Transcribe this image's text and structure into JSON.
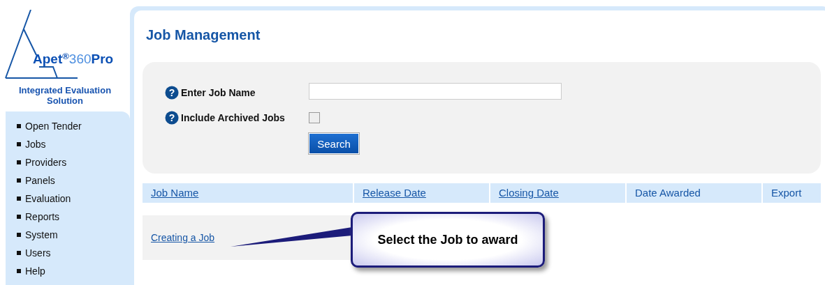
{
  "logo": {
    "wordmark": [
      "Apet",
      "®",
      "360",
      "Pro"
    ],
    "tagline": "Integrated Evaluation Solution"
  },
  "sidebar": {
    "items": [
      "Open Tender",
      "Jobs",
      "Providers",
      "Panels",
      "Evaluation",
      "Reports",
      "System",
      "Users",
      "Help"
    ]
  },
  "page_title": "Job Management",
  "search_form": {
    "job_name": {
      "help_icon": "?",
      "label": "Enter Job Name"
    },
    "archived": {
      "help_icon": "?",
      "label": "Include Archived Jobs",
      "checked": false
    },
    "button": "Search"
  },
  "table": {
    "columns": [
      {
        "label": "Job Name",
        "kind": "link"
      },
      {
        "label": "Release Date",
        "kind": "link"
      },
      {
        "label": "Closing Date",
        "kind": "link"
      },
      {
        "label": "Date Awarded",
        "kind": "plain"
      },
      {
        "label": "Export",
        "kind": "plain"
      }
    ],
    "rows": [
      {
        "job_name": "Creating a Job"
      }
    ]
  },
  "callout": "Select the Job to award"
}
